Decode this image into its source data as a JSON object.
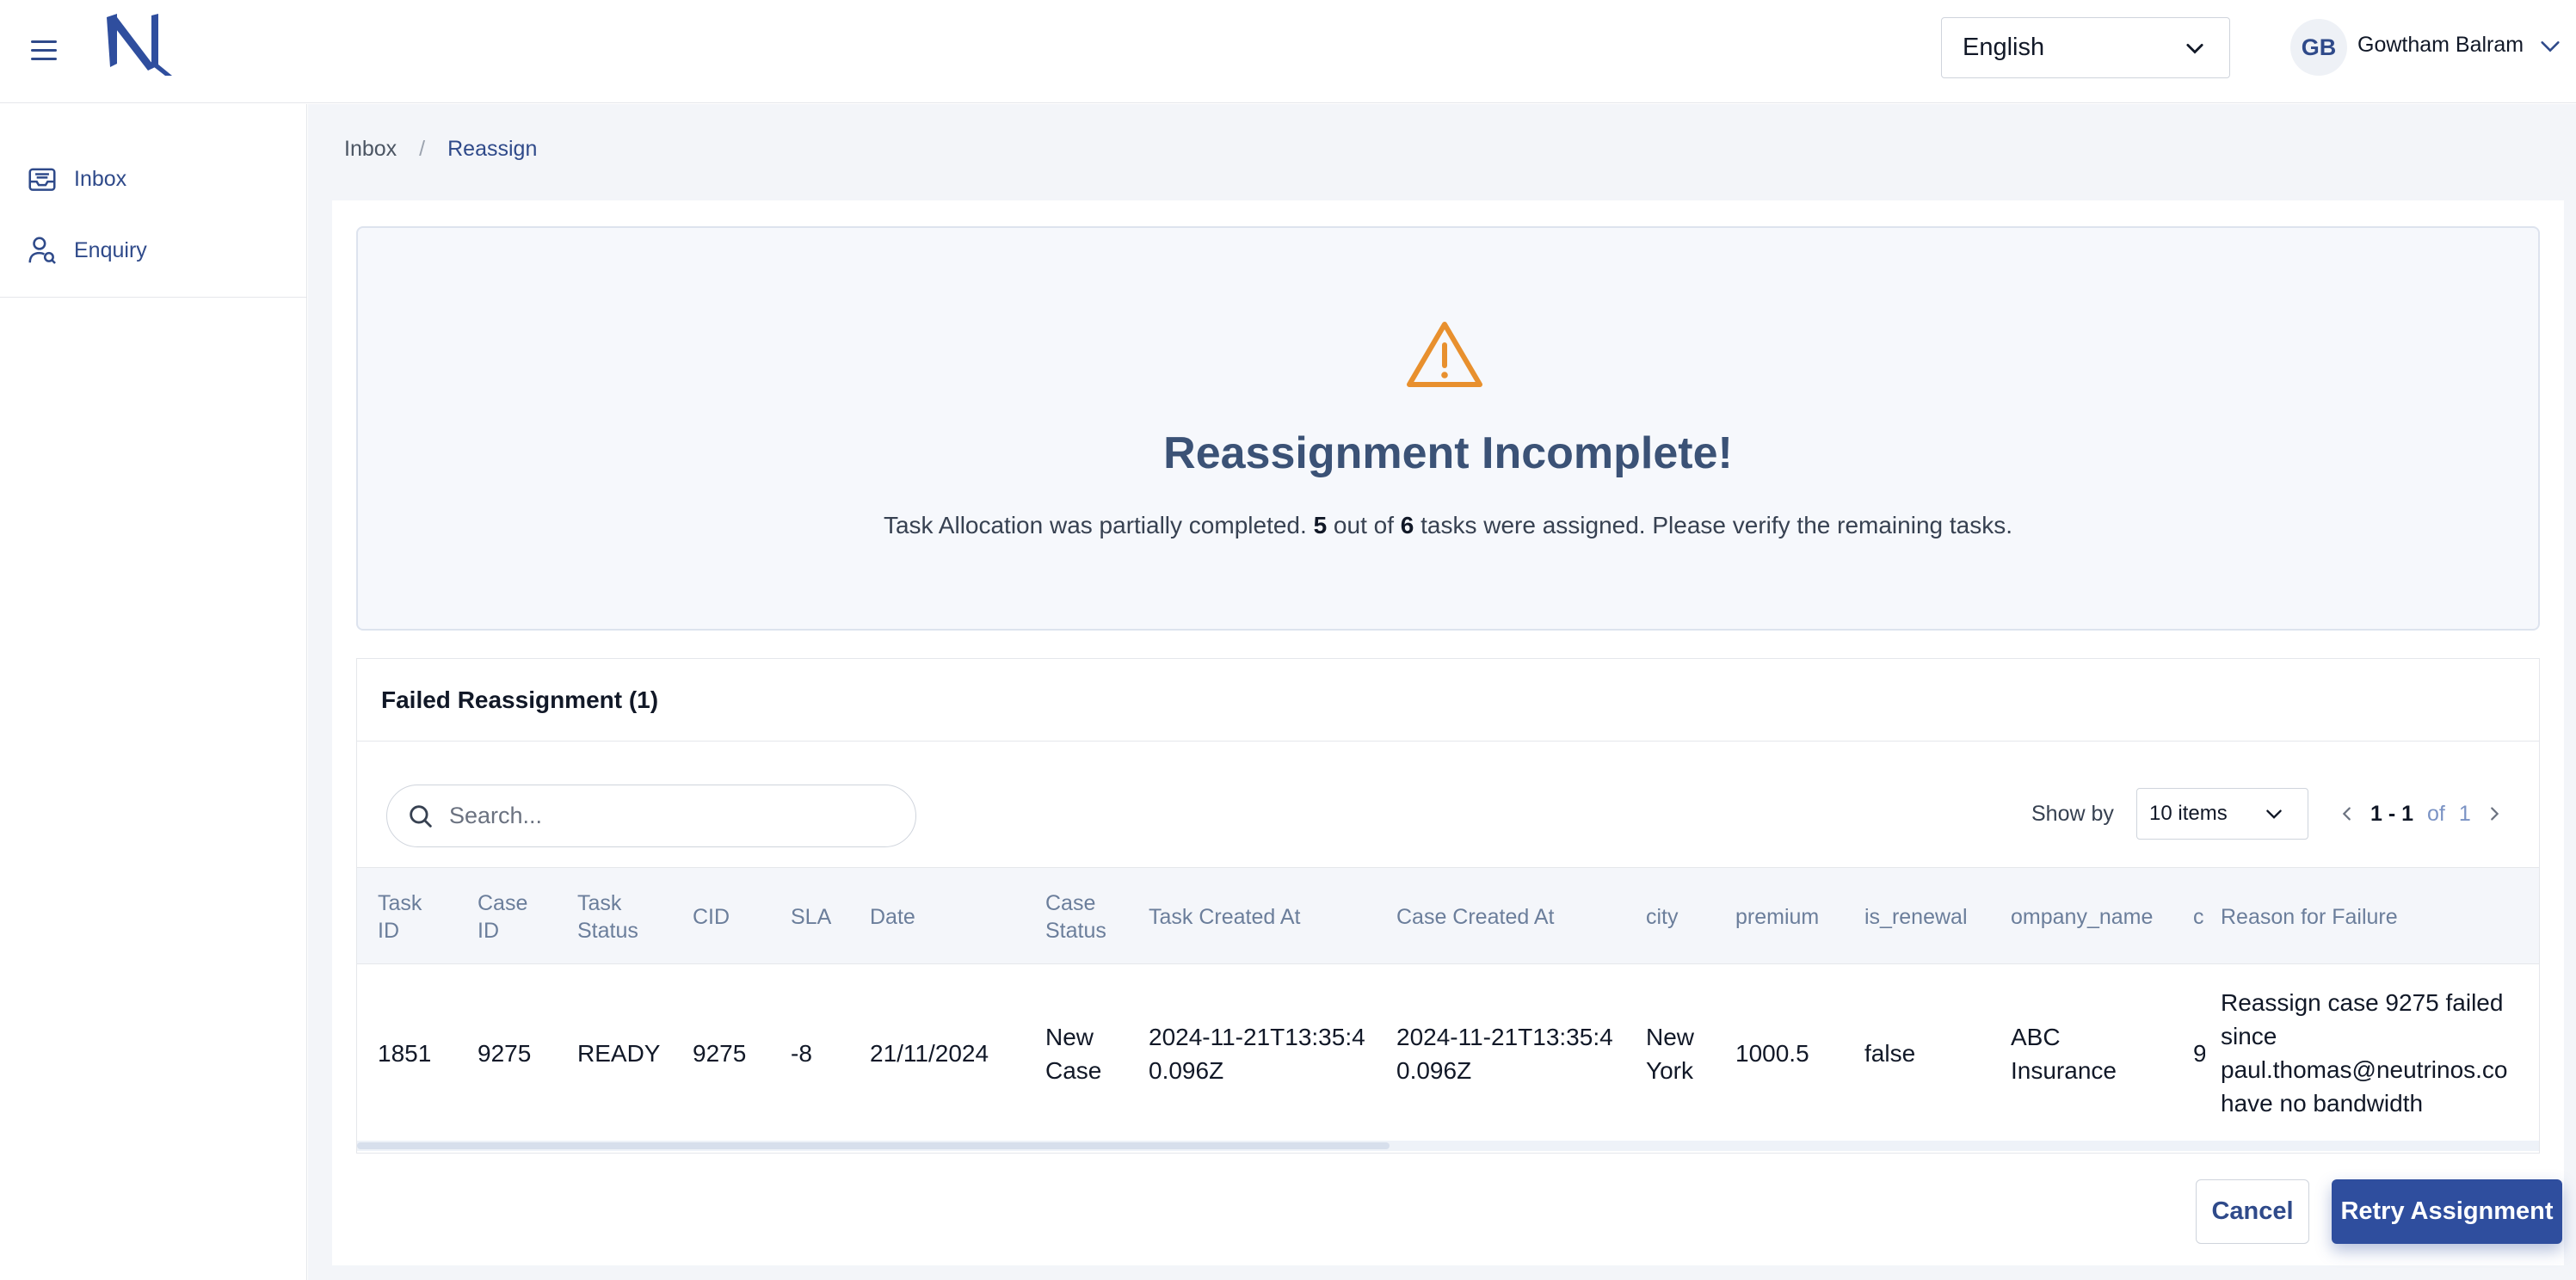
{
  "header": {
    "language": "English",
    "user_initials": "GB",
    "user_name": "Gowtham Balram"
  },
  "sidebar": {
    "items": [
      {
        "label": "Inbox",
        "icon": "inbox-icon"
      },
      {
        "label": "Enquiry",
        "icon": "user-search-icon"
      }
    ]
  },
  "breadcrumb": {
    "items": [
      "Inbox",
      "Reassign"
    ],
    "separator": "/"
  },
  "alert": {
    "icon": "warning-icon",
    "title": "Reassignment Incomplete!",
    "msg_prefix": "Task Allocation was partially completed.",
    "assigned": "5",
    "msg_mid": "out of",
    "total": "6",
    "msg_suffix": "tasks were assigned. Please verify the remaining tasks."
  },
  "failed": {
    "title": "Failed Reassignment (1)",
    "search_placeholder": "Search...",
    "show_by_label": "Show by",
    "items_per_page": "10 items",
    "page_range": "1 - 1",
    "page_of": "of",
    "page_total": "1",
    "columns": [
      "Task ID",
      "Case ID",
      "Task Status",
      "CID",
      "SLA",
      "Date",
      "Case Status",
      "Task Created At",
      "Case Created At",
      "city",
      "premium",
      "is_renewal",
      "ompany_name",
      "c",
      "Reason for Failure"
    ],
    "rows": [
      {
        "task_id": "1851",
        "case_id": "9275",
        "task_status": "READY",
        "cid": "9275",
        "sla": "-8",
        "date": "21/11/2024",
        "case_status": "New Case",
        "task_created_at": "2024-11-21T13:35:40.096Z",
        "case_created_at": "2024-11-21T13:35:40.096Z",
        "city": "New York",
        "premium": "1000.5",
        "is_renewal": "false",
        "company_name": "ABC Insurance",
        "partial": "9",
        "reason": "Reassign case 9275 failed since paul.thomas@neutrinos.co have no bandwidth"
      }
    ]
  },
  "actions": {
    "cancel": "Cancel",
    "retry": "Retry Assignment"
  },
  "colors": {
    "primary": "#2f4e9e",
    "warning": "#e8902e",
    "title": "#3b5276"
  }
}
